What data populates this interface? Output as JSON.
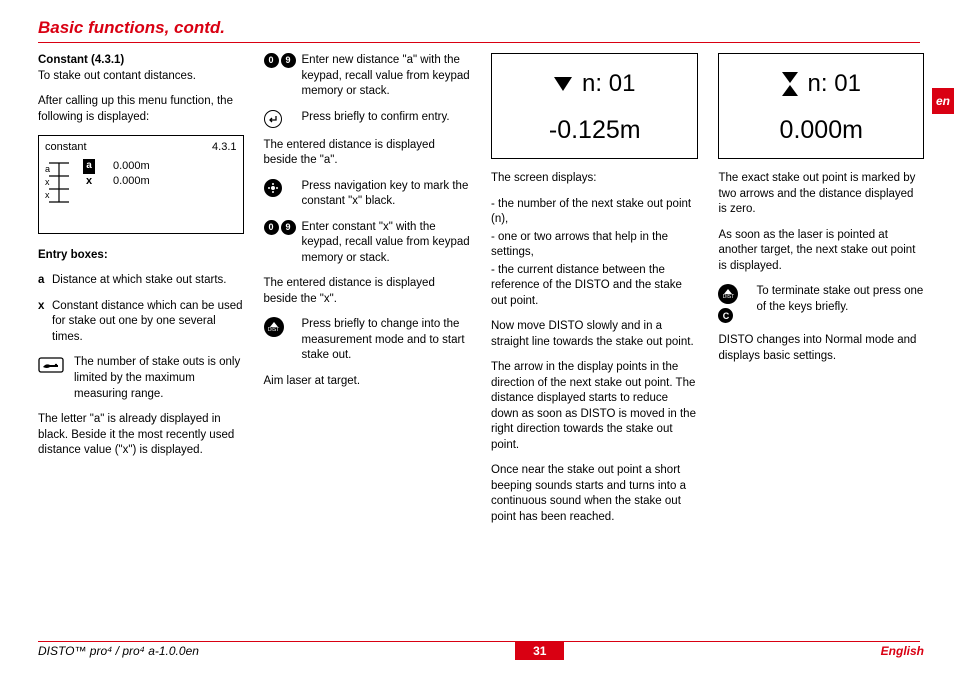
{
  "title": "Basic functions, contd.",
  "lang_tab": "en",
  "col1": {
    "h1": "Constant (4.3.1)",
    "p1": "To stake out contant distances.",
    "p2": "After calling up this menu function, the following is displayed:",
    "box": {
      "label": "constant",
      "code": "4.3.1",
      "a": "a",
      "x": "x",
      "va": "0.000m",
      "vx": "0.000m"
    },
    "h2": "Entry boxes:",
    "ea_lbl": "a",
    "ea_txt": "Distance at which stake out starts.",
    "ex_lbl": "x",
    "ex_txt": "Constant distance which can be used for stake out one by one several times.",
    "note": "The number of stake outs is only limited by the maximum measuring range.",
    "p3": "The letter \"a\" is already displayed in black. Beside it the most recently used distance value (\"x\") is displayed."
  },
  "col2": {
    "i1": "Enter new distance \"a\" with the keypad, recall value from keypad memory or stack.",
    "i2": "Press briefly to confirm entry.",
    "p1": "The entered distance is displayed beside the \"a\".",
    "i3": "Press navigation key to mark the constant \"x\" black.",
    "i4": "Enter constant \"x\" with the keypad, recall value from keypad memory or stack.",
    "p2": "The entered distance is displayed beside the \"x\".",
    "i5": "Press briefly to change into the measurement mode and to start stake out.",
    "p3": "Aim laser at target."
  },
  "col3": {
    "disp_n": "n:  01",
    "disp_v": "-0.125m",
    "p1": "The screen displays:",
    "l1": "- the number of the next stake out point (n),",
    "l2": "- one or two arrows that help in the settings,",
    "l3": "- the current distance between the reference of the  DISTO and the stake out point.",
    "p2": "Now move DISTO slowly and in a straight line towards the stake out point.",
    "p3": "The arrow in the display points in the direction of the next stake out point. The distance displayed starts to reduce down as soon as DISTO is moved in the right direction towards the stake out point.",
    "p4": "Once near the stake out point a short beeping sounds starts and turns into a continuous sound when the stake out point has been reached."
  },
  "col4": {
    "disp_n": "n:  01",
    "disp_v": "0.000m",
    "p1": "The exact stake out point is marked by two arrows and the distance displayed is zero.",
    "p2": "As soon as the laser is pointed at another target, the next stake out point is displayed.",
    "i1": "To terminate stake out press one of the keys briefly.",
    "p3": "DISTO changes into Normal mode and displays basic settings."
  },
  "footer": {
    "left": "DISTO™  pro⁴ / pro⁴ a-1.0.0en",
    "page": "31",
    "right": "English"
  },
  "keys": {
    "k0": "0",
    "k9": "9",
    "kc": "C",
    "dist": "DIST"
  }
}
